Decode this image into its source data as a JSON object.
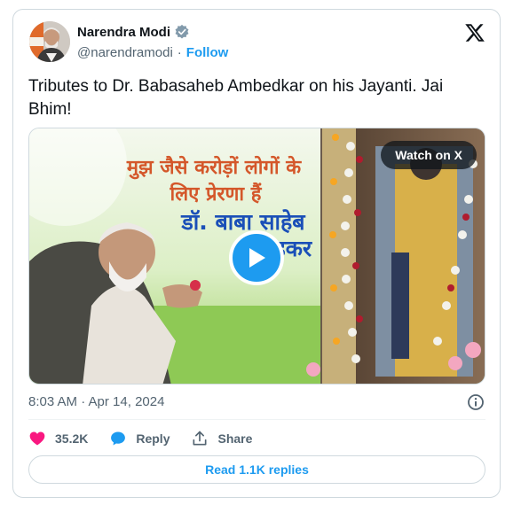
{
  "author": {
    "name": "Narendra Modi",
    "handle": "@narendramodi",
    "follow_label": "Follow",
    "verified": true
  },
  "tweet": {
    "text": "Tributes to Dr. Babasaheb Ambedkar on his Jayanti. Jai Bhim!"
  },
  "media": {
    "watch_label": "Watch on X",
    "overlay_lines": [
      "मुझ जैसे करोड़ों लोगों के",
      "लिए प्रेरणा हैं",
      "डॉ. बाबा साहेब",
      "अम्बेडकर"
    ]
  },
  "meta": {
    "timestamp": "8:03 AM · Apr 14, 2024"
  },
  "actions": {
    "likes": "35.2K",
    "reply_label": "Reply",
    "share_label": "Share"
  },
  "read_replies_label": "Read 1.1K replies",
  "colors": {
    "accent": "#1d9bf0",
    "like": "#f91880",
    "text": "#0f1419",
    "secondary": "#536471"
  }
}
